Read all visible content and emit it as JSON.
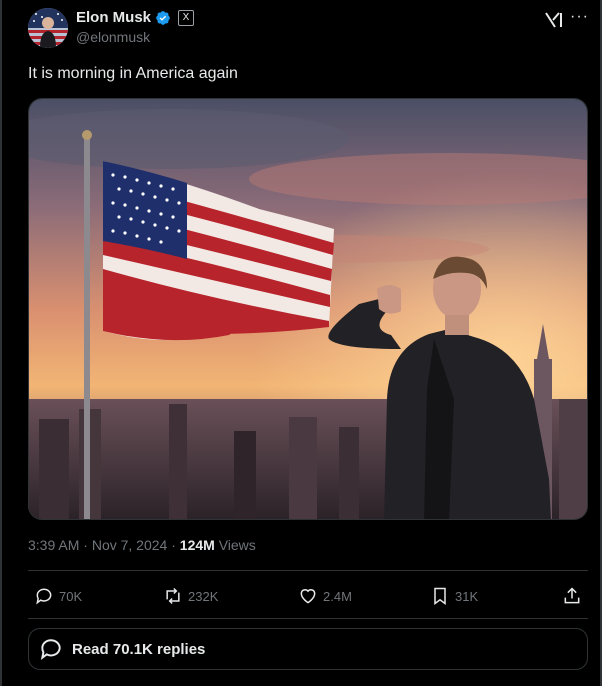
{
  "author": {
    "name": "Elon Musk",
    "handle": "@elonmusk",
    "x_badge": "X"
  },
  "tweet": {
    "text": "It is morning in America again"
  },
  "meta": {
    "time": "3:39 AM",
    "separator1": " · ",
    "date": "Nov 7, 2024",
    "separator2": " · ",
    "views_count": "124M",
    "views_label": " Views"
  },
  "actions": {
    "replies": "70K",
    "reposts": "232K",
    "likes": "2.4M",
    "bookmarks": "31K"
  },
  "replies_button": {
    "label": "Read 70.1K replies"
  },
  "icons": {
    "verified": "verified-badge-icon",
    "grok": "grok-icon",
    "more": "more-icon",
    "reply": "reply-icon",
    "repost": "repost-icon",
    "like": "heart-icon",
    "bookmark": "bookmark-icon",
    "share": "share-icon"
  },
  "colors": {
    "background": "#000000",
    "text": "#e7e9ea",
    "muted": "#71767b",
    "border": "#2f3336",
    "verified_blue": "#1d9bf0"
  }
}
